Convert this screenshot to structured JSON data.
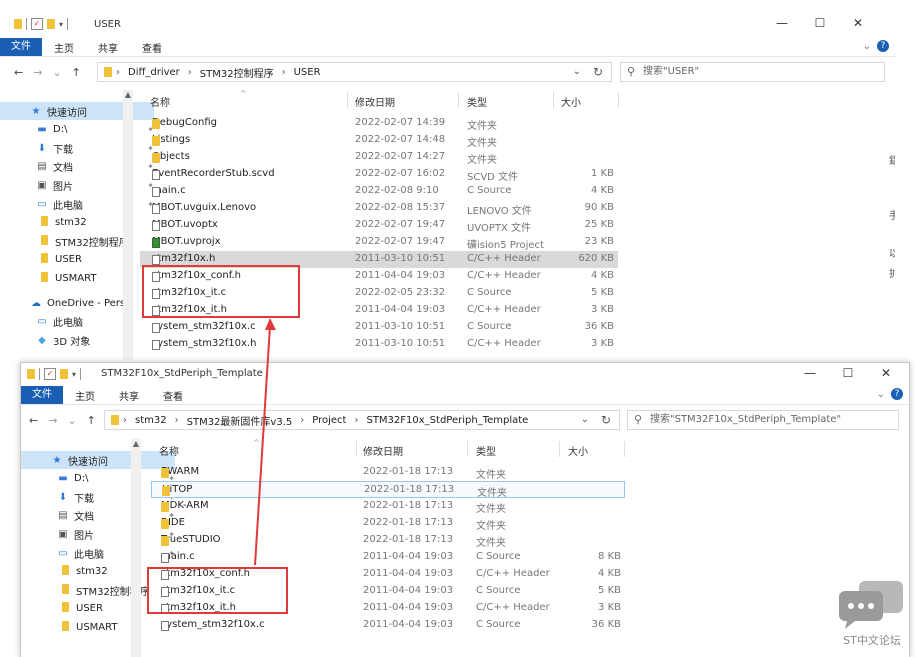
{
  "window1": {
    "title": "USER",
    "ribbon": {
      "file": "文件",
      "tabs": [
        "主页",
        "共享",
        "查看"
      ]
    },
    "controls": {
      "minimize": "—",
      "maximize": "☐",
      "close": "✕"
    },
    "breadcrumb": [
      "Diff_driver",
      "STM32控制程序",
      "USER"
    ],
    "search_placeholder": "搜索\"USER\"",
    "columns": {
      "name": "名称",
      "date": "修改日期",
      "type": "类型",
      "size": "大小"
    },
    "sidebar": [
      {
        "label": "快速访问",
        "icon": "star-icon",
        "pinned": false
      },
      {
        "label": "D:\\",
        "icon": "drive-icon",
        "pinned": true
      },
      {
        "label": "下载",
        "icon": "download-icon",
        "pinned": true
      },
      {
        "label": "文档",
        "icon": "document-icon",
        "pinned": true
      },
      {
        "label": "图片",
        "icon": "picture-icon",
        "pinned": true
      },
      {
        "label": "此电脑",
        "icon": "computer-icon",
        "pinned": true
      },
      {
        "label": "stm32",
        "icon": "folder-icon",
        "pinned": false
      },
      {
        "label": "STM32控制程序",
        "icon": "folder-icon",
        "pinned": false
      },
      {
        "label": "USER",
        "icon": "folder-icon",
        "pinned": false
      },
      {
        "label": "USMART",
        "icon": "folder-icon",
        "pinned": false
      },
      {
        "label": "OneDrive - Persc",
        "icon": "cloud-icon",
        "pinned": false
      },
      {
        "label": "此电脑",
        "icon": "computer-icon",
        "pinned": false
      },
      {
        "label": "3D 对象",
        "icon": "cube-icon",
        "pinned": false
      }
    ],
    "files": [
      {
        "name": "DebugConfig",
        "date": "2022-02-07 14:39",
        "type": "文件夹",
        "size": "",
        "icon": "folder"
      },
      {
        "name": "Listings",
        "date": "2022-02-07 14:48",
        "type": "文件夹",
        "size": "",
        "icon": "folder"
      },
      {
        "name": "Objects",
        "date": "2022-02-07 14:27",
        "type": "文件夹",
        "size": "",
        "icon": "folder"
      },
      {
        "name": "EventRecorderStub.scvd",
        "date": "2022-02-07 16:02",
        "type": "SCVD 文件",
        "size": "1 KB",
        "icon": "file"
      },
      {
        "name": "main.c",
        "date": "2022-02-08 9:10",
        "type": "C Source",
        "size": "4 KB",
        "icon": "file"
      },
      {
        "name": "MBOT.uvguix.Lenovo",
        "date": "2022-02-08 15:37",
        "type": "LENOVO 文件",
        "size": "90 KB",
        "icon": "file"
      },
      {
        "name": "MBOT.uvoptx",
        "date": "2022-02-07 19:47",
        "type": "UVOPTX 文件",
        "size": "25 KB",
        "icon": "file"
      },
      {
        "name": "MBOT.uvprojx",
        "date": "2022-02-07 19:47",
        "type": "礦ision5 Project",
        "size": "23 KB",
        "icon": "project"
      },
      {
        "name": "stm32f10x.h",
        "date": "2011-03-10 10:51",
        "type": "C/C++ Header",
        "size": "620 KB",
        "icon": "file"
      },
      {
        "name": "stm32f10x_conf.h",
        "date": "2011-04-04 19:03",
        "type": "C/C++ Header",
        "size": "4 KB",
        "icon": "file"
      },
      {
        "name": "stm32f10x_it.c",
        "date": "2022-02-05 23:32",
        "type": "C Source",
        "size": "5 KB",
        "icon": "file"
      },
      {
        "name": "stm32f10x_it.h",
        "date": "2011-04-04 19:03",
        "type": "C/C++ Header",
        "size": "3 KB",
        "icon": "file"
      },
      {
        "name": "system_stm32f10x.c",
        "date": "2011-03-10 10:51",
        "type": "C Source",
        "size": "36 KB",
        "icon": "file"
      },
      {
        "name": "system_stm32f10x.h",
        "date": "2011-03-10 10:51",
        "type": "C/C++ Header",
        "size": "3 KB",
        "icon": "file"
      }
    ],
    "edge_chars": [
      "鋁",
      "手",
      "以",
      "扩"
    ]
  },
  "window2": {
    "title": "STM32F10x_StdPeriph_Template",
    "ribbon": {
      "file": "文件",
      "tabs": [
        "主页",
        "共享",
        "查看"
      ]
    },
    "controls": {
      "minimize": "—",
      "maximize": "☐",
      "close": "✕"
    },
    "breadcrumb": [
      "stm32",
      "STM32最新固件库v3.5",
      "Project",
      "STM32F10x_StdPeriph_Template"
    ],
    "search_placeholder": "搜索\"STM32F10x_StdPeriph_Template\"",
    "columns": {
      "name": "名称",
      "date": "修改日期",
      "type": "类型",
      "size": "大小"
    },
    "sidebar": [
      {
        "label": "快速访问",
        "icon": "star-icon",
        "pinned": false
      },
      {
        "label": "D:\\",
        "icon": "drive-icon",
        "pinned": true
      },
      {
        "label": "下载",
        "icon": "download-icon",
        "pinned": true
      },
      {
        "label": "文档",
        "icon": "document-icon",
        "pinned": true
      },
      {
        "label": "图片",
        "icon": "picture-icon",
        "pinned": true
      },
      {
        "label": "此电脑",
        "icon": "computer-icon",
        "pinned": true
      },
      {
        "label": "stm32",
        "icon": "folder-icon",
        "pinned": false
      },
      {
        "label": "STM32控制程序",
        "icon": "folder-icon",
        "pinned": false
      },
      {
        "label": "USER",
        "icon": "folder-icon",
        "pinned": false
      },
      {
        "label": "USMART",
        "icon": "folder-icon",
        "pinned": false
      }
    ],
    "files": [
      {
        "name": "EWARM",
        "date": "2022-01-18 17:13",
        "type": "文件夹",
        "size": "",
        "icon": "folder"
      },
      {
        "name": "HiTOP",
        "date": "2022-01-18 17:13",
        "type": "文件夹",
        "size": "",
        "icon": "folder"
      },
      {
        "name": "MDK-ARM",
        "date": "2022-01-18 17:13",
        "type": "文件夹",
        "size": "",
        "icon": "folder"
      },
      {
        "name": "RIDE",
        "date": "2022-01-18 17:13",
        "type": "文件夹",
        "size": "",
        "icon": "folder"
      },
      {
        "name": "TrueSTUDIO",
        "date": "2022-01-18 17:13",
        "type": "文件夹",
        "size": "",
        "icon": "folder"
      },
      {
        "name": "main.c",
        "date": "2011-04-04 19:03",
        "type": "C Source",
        "size": "8 KB",
        "icon": "file"
      },
      {
        "name": "stm32f10x_conf.h",
        "date": "2011-04-04 19:03",
        "type": "C/C++ Header",
        "size": "4 KB",
        "icon": "file"
      },
      {
        "name": "stm32f10x_it.c",
        "date": "2011-04-04 19:03",
        "type": "C Source",
        "size": "5 KB",
        "icon": "file"
      },
      {
        "name": "stm32f10x_it.h",
        "date": "2011-04-04 19:03",
        "type": "C/C++ Header",
        "size": "3 KB",
        "icon": "file"
      },
      {
        "name": "system_stm32f10x.c",
        "date": "2011-04-04 19:03",
        "type": "C Source",
        "size": "36 KB",
        "icon": "file"
      }
    ]
  },
  "watermark": {
    "text": "ST中文论坛"
  },
  "colors": {
    "accent": "#1a5fb4",
    "highlight": "#e03a3a",
    "folder": "#f0c23a"
  }
}
